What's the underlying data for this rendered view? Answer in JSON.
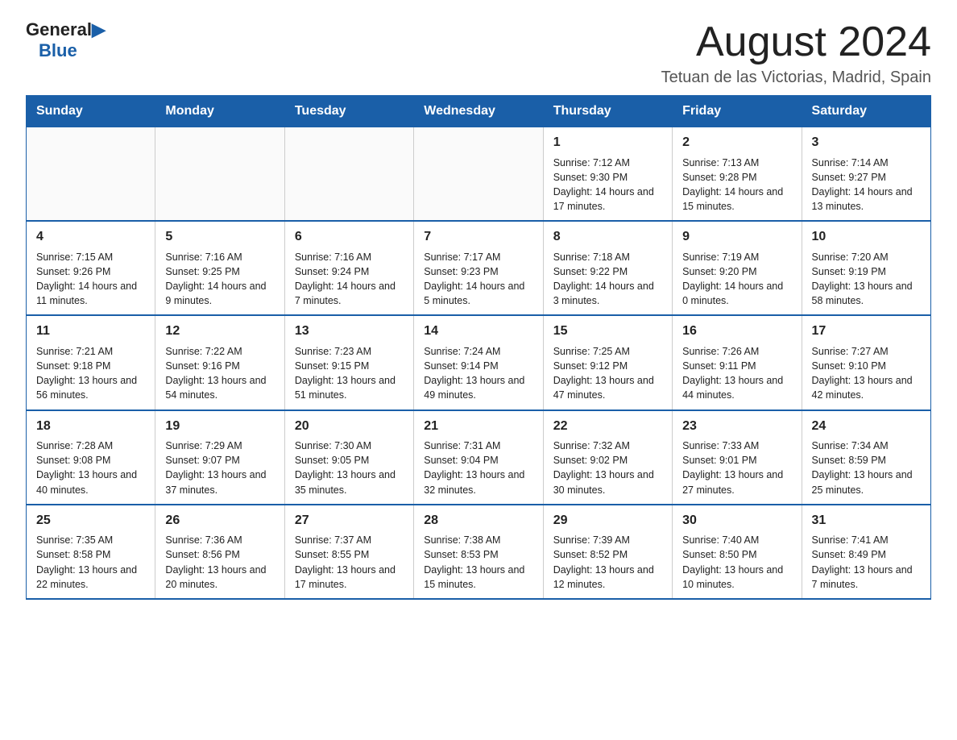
{
  "logo": {
    "general": "General",
    "blue": "Blue"
  },
  "title": "August 2024",
  "location": "Tetuan de las Victorias, Madrid, Spain",
  "days_of_week": [
    "Sunday",
    "Monday",
    "Tuesday",
    "Wednesday",
    "Thursday",
    "Friday",
    "Saturday"
  ],
  "weeks": [
    [
      {
        "day": "",
        "info": ""
      },
      {
        "day": "",
        "info": ""
      },
      {
        "day": "",
        "info": ""
      },
      {
        "day": "",
        "info": ""
      },
      {
        "day": "1",
        "info": "Sunrise: 7:12 AM\nSunset: 9:30 PM\nDaylight: 14 hours and 17 minutes."
      },
      {
        "day": "2",
        "info": "Sunrise: 7:13 AM\nSunset: 9:28 PM\nDaylight: 14 hours and 15 minutes."
      },
      {
        "day": "3",
        "info": "Sunrise: 7:14 AM\nSunset: 9:27 PM\nDaylight: 14 hours and 13 minutes."
      }
    ],
    [
      {
        "day": "4",
        "info": "Sunrise: 7:15 AM\nSunset: 9:26 PM\nDaylight: 14 hours and 11 minutes."
      },
      {
        "day": "5",
        "info": "Sunrise: 7:16 AM\nSunset: 9:25 PM\nDaylight: 14 hours and 9 minutes."
      },
      {
        "day": "6",
        "info": "Sunrise: 7:16 AM\nSunset: 9:24 PM\nDaylight: 14 hours and 7 minutes."
      },
      {
        "day": "7",
        "info": "Sunrise: 7:17 AM\nSunset: 9:23 PM\nDaylight: 14 hours and 5 minutes."
      },
      {
        "day": "8",
        "info": "Sunrise: 7:18 AM\nSunset: 9:22 PM\nDaylight: 14 hours and 3 minutes."
      },
      {
        "day": "9",
        "info": "Sunrise: 7:19 AM\nSunset: 9:20 PM\nDaylight: 14 hours and 0 minutes."
      },
      {
        "day": "10",
        "info": "Sunrise: 7:20 AM\nSunset: 9:19 PM\nDaylight: 13 hours and 58 minutes."
      }
    ],
    [
      {
        "day": "11",
        "info": "Sunrise: 7:21 AM\nSunset: 9:18 PM\nDaylight: 13 hours and 56 minutes."
      },
      {
        "day": "12",
        "info": "Sunrise: 7:22 AM\nSunset: 9:16 PM\nDaylight: 13 hours and 54 minutes."
      },
      {
        "day": "13",
        "info": "Sunrise: 7:23 AM\nSunset: 9:15 PM\nDaylight: 13 hours and 51 minutes."
      },
      {
        "day": "14",
        "info": "Sunrise: 7:24 AM\nSunset: 9:14 PM\nDaylight: 13 hours and 49 minutes."
      },
      {
        "day": "15",
        "info": "Sunrise: 7:25 AM\nSunset: 9:12 PM\nDaylight: 13 hours and 47 minutes."
      },
      {
        "day": "16",
        "info": "Sunrise: 7:26 AM\nSunset: 9:11 PM\nDaylight: 13 hours and 44 minutes."
      },
      {
        "day": "17",
        "info": "Sunrise: 7:27 AM\nSunset: 9:10 PM\nDaylight: 13 hours and 42 minutes."
      }
    ],
    [
      {
        "day": "18",
        "info": "Sunrise: 7:28 AM\nSunset: 9:08 PM\nDaylight: 13 hours and 40 minutes."
      },
      {
        "day": "19",
        "info": "Sunrise: 7:29 AM\nSunset: 9:07 PM\nDaylight: 13 hours and 37 minutes."
      },
      {
        "day": "20",
        "info": "Sunrise: 7:30 AM\nSunset: 9:05 PM\nDaylight: 13 hours and 35 minutes."
      },
      {
        "day": "21",
        "info": "Sunrise: 7:31 AM\nSunset: 9:04 PM\nDaylight: 13 hours and 32 minutes."
      },
      {
        "day": "22",
        "info": "Sunrise: 7:32 AM\nSunset: 9:02 PM\nDaylight: 13 hours and 30 minutes."
      },
      {
        "day": "23",
        "info": "Sunrise: 7:33 AM\nSunset: 9:01 PM\nDaylight: 13 hours and 27 minutes."
      },
      {
        "day": "24",
        "info": "Sunrise: 7:34 AM\nSunset: 8:59 PM\nDaylight: 13 hours and 25 minutes."
      }
    ],
    [
      {
        "day": "25",
        "info": "Sunrise: 7:35 AM\nSunset: 8:58 PM\nDaylight: 13 hours and 22 minutes."
      },
      {
        "day": "26",
        "info": "Sunrise: 7:36 AM\nSunset: 8:56 PM\nDaylight: 13 hours and 20 minutes."
      },
      {
        "day": "27",
        "info": "Sunrise: 7:37 AM\nSunset: 8:55 PM\nDaylight: 13 hours and 17 minutes."
      },
      {
        "day": "28",
        "info": "Sunrise: 7:38 AM\nSunset: 8:53 PM\nDaylight: 13 hours and 15 minutes."
      },
      {
        "day": "29",
        "info": "Sunrise: 7:39 AM\nSunset: 8:52 PM\nDaylight: 13 hours and 12 minutes."
      },
      {
        "day": "30",
        "info": "Sunrise: 7:40 AM\nSunset: 8:50 PM\nDaylight: 13 hours and 10 minutes."
      },
      {
        "day": "31",
        "info": "Sunrise: 7:41 AM\nSunset: 8:49 PM\nDaylight: 13 hours and 7 minutes."
      }
    ]
  ]
}
